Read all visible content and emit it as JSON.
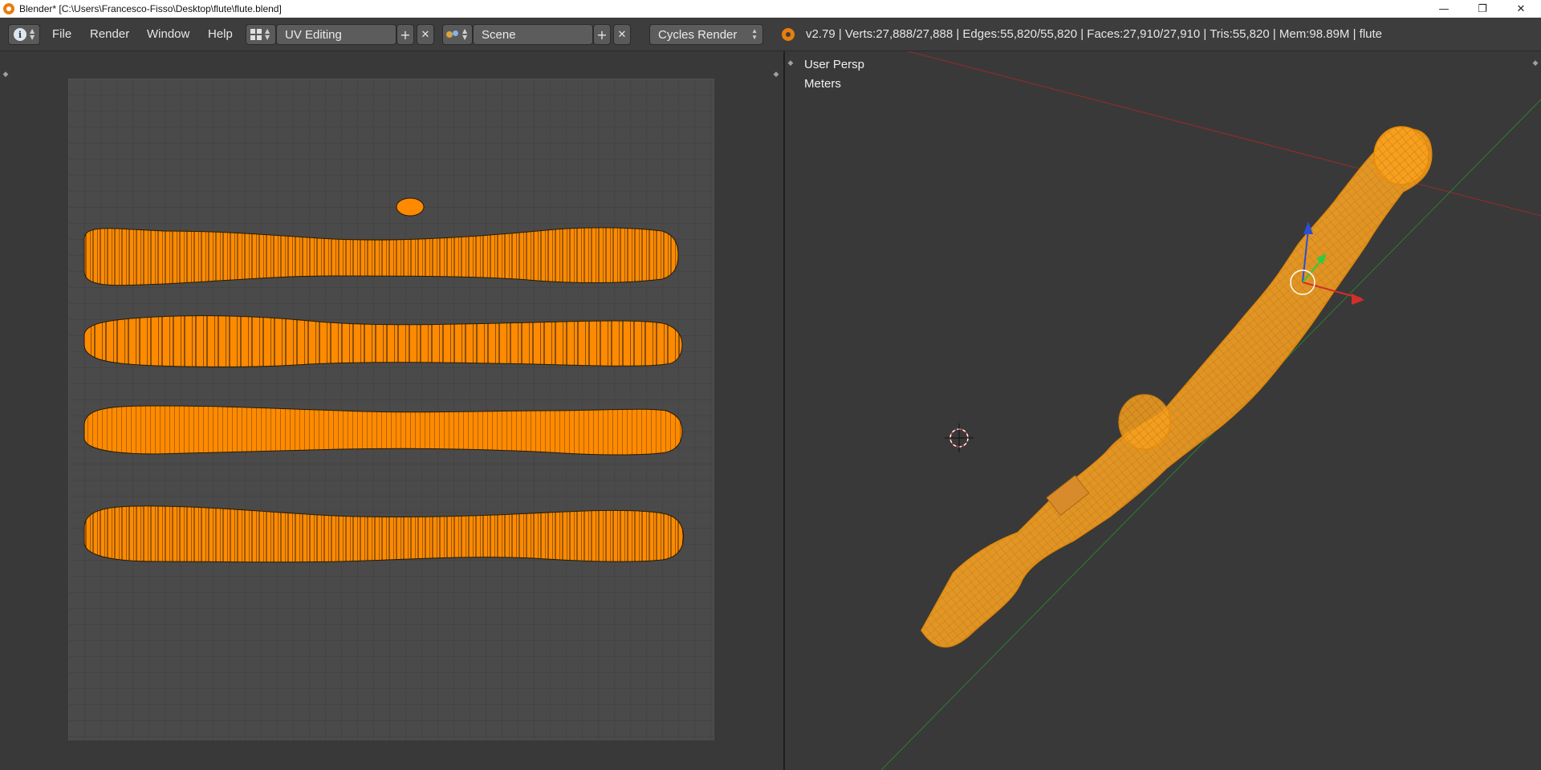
{
  "window": {
    "title": "Blender* [C:\\Users\\Francesco-Fisso\\Desktop\\flute\\flute.blend]",
    "controls": {
      "minimize": "—",
      "maximize": "❐",
      "close": "✕"
    }
  },
  "header": {
    "menus": [
      "File",
      "Render",
      "Window",
      "Help"
    ],
    "layout_name": "UV Editing",
    "scene_name": "Scene",
    "render_engine": "Cycles Render",
    "add_symbol": "+",
    "close_symbol": "✕",
    "stats": "v2.79 | Verts:27,888/27,888 | Edges:55,820/55,820 | Faces:27,910/27,910 | Tris:55,820 | Mem:98.89M | flute"
  },
  "viewport": {
    "view_label": "User Persp",
    "units_label": "Meters"
  },
  "colors": {
    "accent_orange": "#ff8a00",
    "grid_bg": "#4a4a4a",
    "panel_bg": "#393939",
    "header_bg": "#3d3d3d",
    "axis_x": "#c0392b",
    "axis_y": "#27ae60",
    "axis_z": "#2a4fd6"
  }
}
